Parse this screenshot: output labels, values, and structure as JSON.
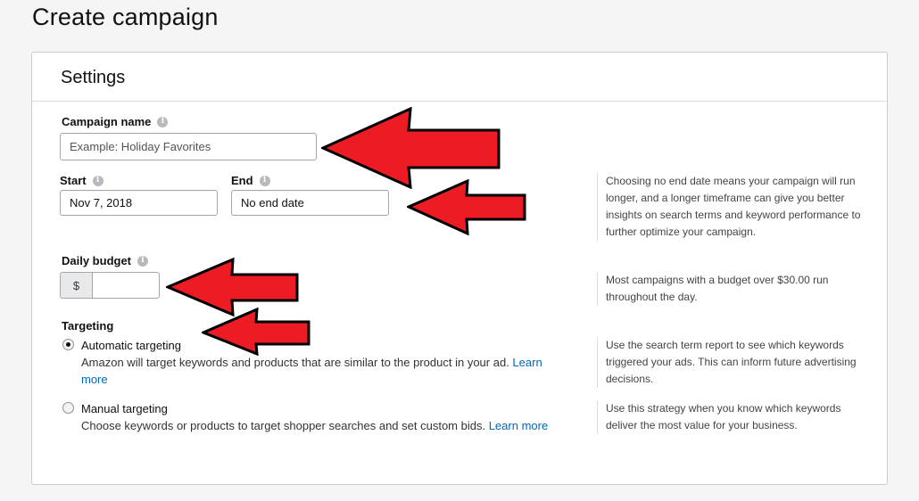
{
  "page": {
    "title": "Create campaign"
  },
  "settings": {
    "title": "Settings",
    "campaign_name": {
      "label": "Campaign name",
      "placeholder": "Example: Holiday Favorites"
    },
    "start": {
      "label": "Start",
      "value": "Nov 7, 2018"
    },
    "end": {
      "label": "End",
      "value": "No end date"
    },
    "end_help": "Choosing no end date means your campaign will run longer, and a longer timeframe can give you better insights on search terms and keyword performance to further optimize your campaign.",
    "daily_budget": {
      "label": "Daily budget",
      "currency": "$",
      "value": ""
    },
    "budget_help": "Most campaigns with a budget over $30.00 run throughout the day.",
    "targeting": {
      "label": "Targeting",
      "automatic": {
        "title": "Automatic targeting",
        "desc": "Amazon will target keywords and products that are similar to the product in your ad.",
        "link": "Learn more",
        "selected": true,
        "help": "Use the search term report to see which keywords triggered your ads. This can inform future advertising decisions."
      },
      "manual": {
        "title": "Manual targeting",
        "desc": "Choose keywords or products to target shopper searches and set custom bids.",
        "link": "Learn more",
        "selected": false,
        "help": "Use this strategy when you know which keywords deliver the most value for your business."
      }
    }
  },
  "icons": {
    "info": "info-icon",
    "arrow": "red-arrow-icon"
  },
  "colors": {
    "link": "#0066c0",
    "annotation_arrow": "#ed1c24"
  }
}
